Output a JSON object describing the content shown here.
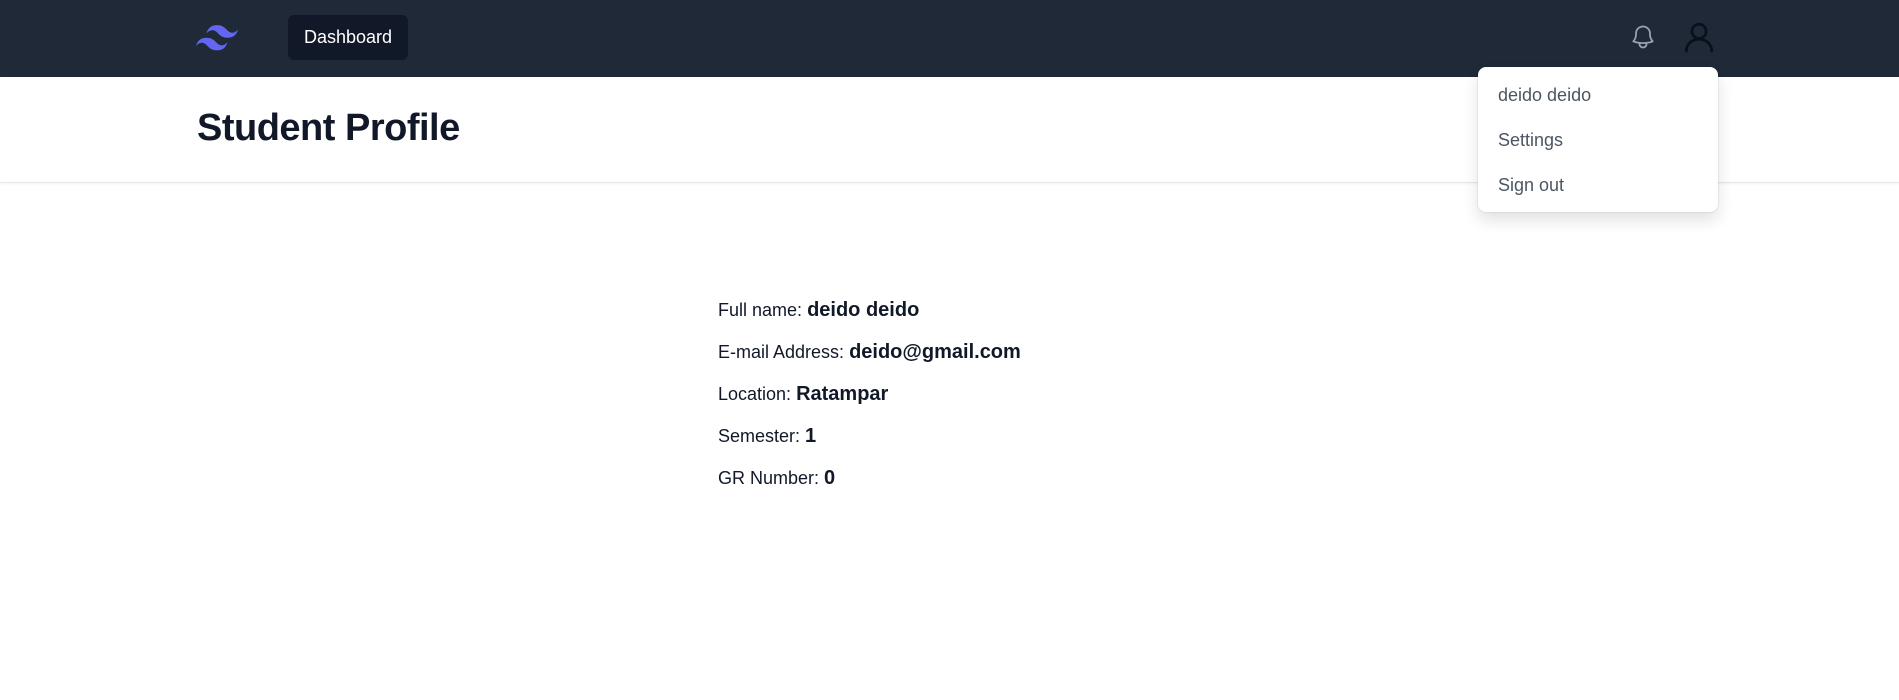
{
  "navbar": {
    "logo_icon": "tailwind-logo-icon",
    "logo_color": "#6366f1",
    "background": "#1f2937",
    "dashboard_label": "Dashboard",
    "notification_icon": "bell-icon",
    "user_icon": "user-icon"
  },
  "header": {
    "title": "Student Profile"
  },
  "user_menu": {
    "items": [
      {
        "label": "deido deido"
      },
      {
        "label": "Settings"
      },
      {
        "label": "Sign out"
      }
    ]
  },
  "profile": {
    "fields": [
      {
        "label": "Full name:",
        "value": "deido deido"
      },
      {
        "label": "E-mail Address:",
        "value": "deido@gmail.com"
      },
      {
        "label": "Location:",
        "value": "Ratampar"
      },
      {
        "label": "Semester:",
        "value": "1"
      },
      {
        "label": "GR Number:",
        "value": "0"
      }
    ]
  }
}
